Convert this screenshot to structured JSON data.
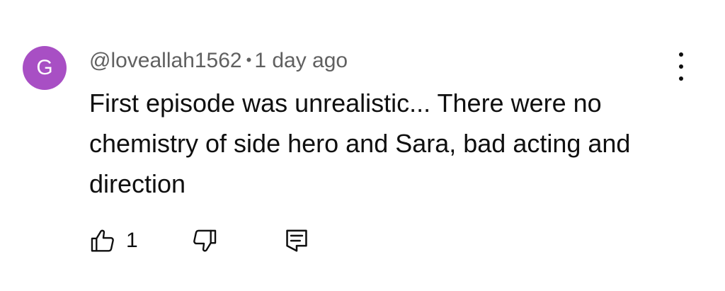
{
  "comment": {
    "avatar_letter": "G",
    "avatar_color": "#a84fc4",
    "author": "@loveallah1562",
    "separator": "•",
    "time": "1 day ago",
    "text": "First episode was unrealistic... There were no chemistry of side hero and Sara, bad acting and direction",
    "like_count": "1",
    "icons": {
      "like": "thumbs-up-icon",
      "dislike": "thumbs-down-icon",
      "reply": "reply-comment-icon",
      "menu": "more-vert-icon"
    }
  }
}
